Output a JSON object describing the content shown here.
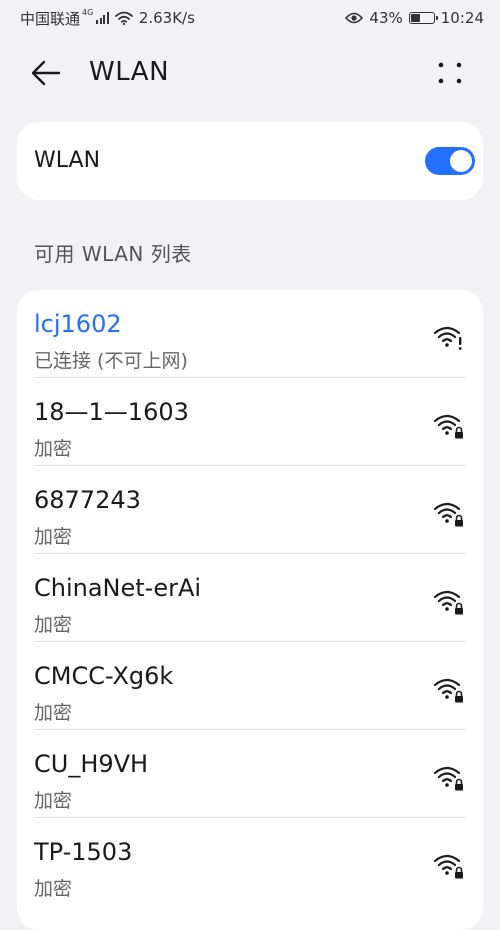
{
  "status_bar": {
    "carrier": "中国联通",
    "network_type": "4G",
    "speed": "2.63K/s",
    "battery_percent": "43%",
    "battery_level": 0.43,
    "time": "10:24"
  },
  "header": {
    "title": "WLAN"
  },
  "wlan_toggle": {
    "label": "WLAN",
    "enabled": true,
    "accent_color": "#256fff"
  },
  "section": {
    "available_title": "可用 WLAN 列表"
  },
  "networks": [
    {
      "ssid": "lcj1602",
      "status": "已连接 (不可上网)",
      "connected": true,
      "icon": "wifi-warning-icon"
    },
    {
      "ssid": "18—1—1603",
      "status": "加密",
      "connected": false,
      "icon": "wifi-lock-icon"
    },
    {
      "ssid": "6877243",
      "status": "加密",
      "connected": false,
      "icon": "wifi-lock-icon"
    },
    {
      "ssid": "ChinaNet-erAi",
      "status": "加密",
      "connected": false,
      "icon": "wifi-lock-icon"
    },
    {
      "ssid": "CMCC-Xg6k",
      "status": "加密",
      "connected": false,
      "icon": "wifi-lock-icon"
    },
    {
      "ssid": "CU_H9VH",
      "status": "加密",
      "connected": false,
      "icon": "wifi-lock-icon"
    },
    {
      "ssid": "TP-1503",
      "status": "加密",
      "connected": false,
      "icon": "wifi-lock-icon"
    }
  ]
}
